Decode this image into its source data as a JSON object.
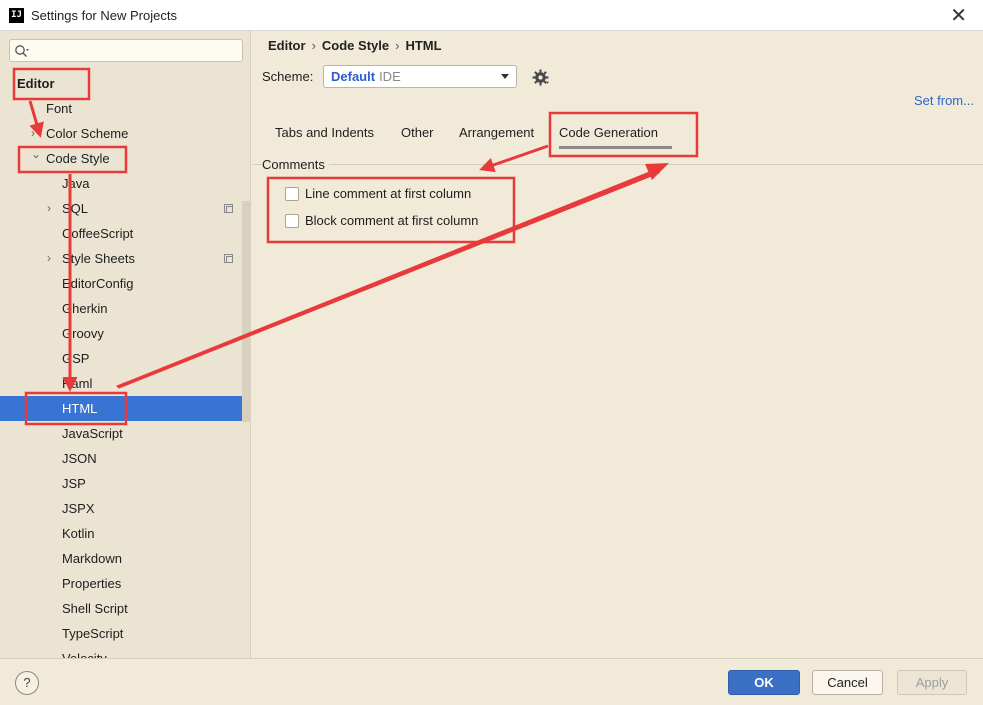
{
  "window": {
    "app_icon_text": "IJ",
    "title": "Settings for New Projects",
    "close_glyph": "✕"
  },
  "sidebar": {
    "search": {
      "value": "",
      "placeholder": ""
    },
    "tree": [
      {
        "label": "Editor",
        "bold": true,
        "expanded": null
      },
      {
        "label": "Font"
      },
      {
        "label": "Color Scheme",
        "collapsed": true
      },
      {
        "label": "Code Style",
        "expanded": true
      },
      {
        "label": "Java"
      },
      {
        "label": "SQL",
        "collapsed": true,
        "copy_icon": true
      },
      {
        "label": "CoffeeScript"
      },
      {
        "label": "Style Sheets",
        "collapsed": true,
        "copy_icon": true
      },
      {
        "label": "EditorConfig"
      },
      {
        "label": "Gherkin"
      },
      {
        "label": "Groovy"
      },
      {
        "label": "GSP"
      },
      {
        "label": "Haml"
      },
      {
        "label": "HTML",
        "selected": true
      },
      {
        "label": "JavaScript"
      },
      {
        "label": "JSON"
      },
      {
        "label": "JSP"
      },
      {
        "label": "JSPX"
      },
      {
        "label": "Kotlin"
      },
      {
        "label": "Markdown"
      },
      {
        "label": "Properties"
      },
      {
        "label": "Shell Script"
      },
      {
        "label": "TypeScript"
      },
      {
        "label": "Velocity"
      }
    ]
  },
  "main": {
    "breadcrumb": [
      "Editor",
      "Code Style",
      "HTML"
    ],
    "breadcrumb_sep": "›",
    "scheme": {
      "label": "Scheme:",
      "value": "Default",
      "suffix": "IDE"
    },
    "set_from": "Set from...",
    "tabs": [
      {
        "label": "Tabs and Indents"
      },
      {
        "label": "Other"
      },
      {
        "label": "Arrangement"
      },
      {
        "label": "Code Generation",
        "active": true
      }
    ],
    "comments": {
      "title": "Comments",
      "options": [
        {
          "label": "Line comment at first column",
          "checked": false
        },
        {
          "label": "Block comment at first column",
          "checked": false
        }
      ]
    }
  },
  "footer": {
    "help": "?",
    "ok": "OK",
    "cancel": "Cancel",
    "apply": "Apply"
  },
  "colors": {
    "annotation": "#e83a3a",
    "selection": "#3874d4",
    "link": "#2d67c7",
    "background": "#f1ead9"
  }
}
